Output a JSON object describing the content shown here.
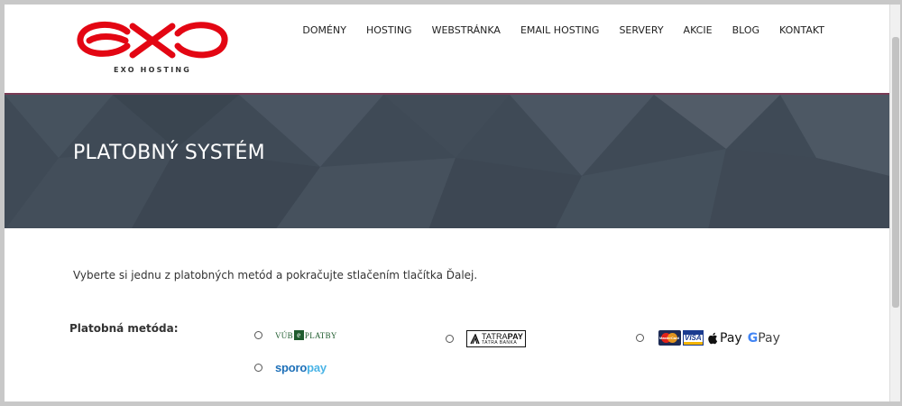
{
  "brand": {
    "logo_text": "EXO HOSTING",
    "logo_color": "#e30613"
  },
  "nav": {
    "items": [
      {
        "label": "DOMÉNY"
      },
      {
        "label": "HOSTING"
      },
      {
        "label": "WEBSTRÁNKA"
      },
      {
        "label": "EMAIL HOSTING"
      },
      {
        "label": "SERVERY"
      },
      {
        "label": "AKCIE"
      },
      {
        "label": "BLOG"
      },
      {
        "label": "KONTAKT"
      }
    ]
  },
  "banner": {
    "title": "PLATOBNÝ SYSTÉM",
    "background_color": "#3f4a56",
    "accent_color": "#7a3b55"
  },
  "content": {
    "intro": "Vyberte si jednu z platobných metód a pokračujte stlačením tlačítka Ďalej.",
    "method_label": "Platobná metóda:"
  },
  "payment_methods": {
    "vub": {
      "left": "VÚB",
      "mark": "e",
      "right": "PLATBY"
    },
    "tatra": {
      "main_a": "TATRA",
      "main_b": "PAY",
      "sub": "TATRA BANKA"
    },
    "cards": {
      "mastercard": "MasterCard",
      "visa": "VISA",
      "apple_pay": "Pay",
      "gpay_g": "G",
      "gpay_text": "Pay"
    },
    "sporo": {
      "part_a": "sporo",
      "part_b": "pay"
    }
  }
}
